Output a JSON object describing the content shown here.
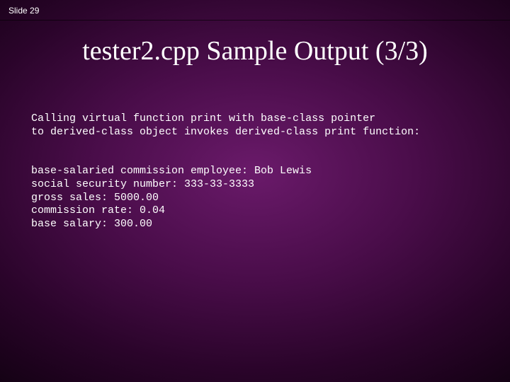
{
  "slide": {
    "label": "Slide 29",
    "title": "tester2.cpp Sample Output (3/3)"
  },
  "output": {
    "description_line1": "Calling virtual function print with base-class pointer",
    "description_line2": "to derived-class object invokes derived-class print function:",
    "line_employee": "base-salaried commission employee: Bob Lewis",
    "line_ssn": "social security number: 333-33-3333",
    "line_gross": "gross sales: 5000.00",
    "line_rate": "commission rate: 0.04",
    "line_base": "base salary: 300.00"
  }
}
